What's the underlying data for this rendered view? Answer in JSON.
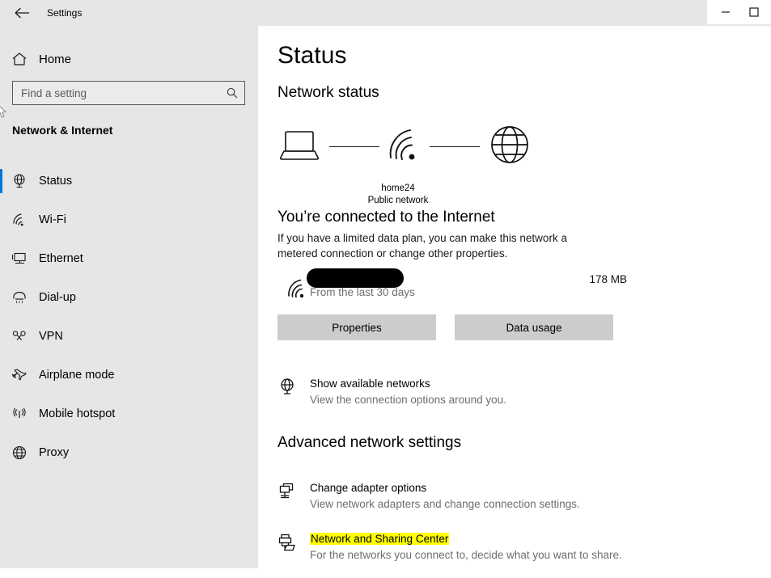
{
  "window": {
    "title": "Settings",
    "back_icon": "back-arrow-icon",
    "minimize_label": "—",
    "maximize_label": "❐"
  },
  "sidebar": {
    "home_label": "Home",
    "home_icon": "home-icon",
    "search": {
      "placeholder": "Find a setting",
      "value": "",
      "icon": "search-icon"
    },
    "category": "Network & Internet",
    "items": [
      {
        "label": "Status",
        "icon": "globe-monitor-icon",
        "selected": true
      },
      {
        "label": "Wi-Fi",
        "icon": "wifi-icon",
        "selected": false
      },
      {
        "label": "Ethernet",
        "icon": "ethernet-icon",
        "selected": false
      },
      {
        "label": "Dial-up",
        "icon": "dialup-phone-icon",
        "selected": false
      },
      {
        "label": "VPN",
        "icon": "vpn-key-icon",
        "selected": false
      },
      {
        "label": "Airplane mode",
        "icon": "airplane-icon",
        "selected": false
      },
      {
        "label": "Mobile hotspot",
        "icon": "hotspot-icon",
        "selected": false
      },
      {
        "label": "Proxy",
        "icon": "globe-icon",
        "selected": false
      }
    ]
  },
  "main": {
    "page_title": "Status",
    "network_status_heading": "Network status",
    "diagram": {
      "device_icon": "laptop-icon",
      "network_icon": "wifi-icon",
      "internet_icon": "globe-icon",
      "network_name": "home24",
      "network_type": "Public network"
    },
    "connected_heading": "You’re connected to the Internet",
    "connected_description": "If you have a limited data plan, you can make this network a metered connection or change other properties.",
    "usage": {
      "icon": "wifi-icon",
      "network_name_redacted": "",
      "period": "From the last 30 days",
      "amount": "178 MB"
    },
    "buttons": {
      "properties": "Properties",
      "data_usage": "Data usage"
    },
    "show_networks": {
      "icon": "globe-monitor-icon",
      "title": "Show available networks",
      "subtitle": "View the connection options around you."
    },
    "advanced_heading": "Advanced network settings",
    "advanced_items": [
      {
        "icon": "adapter-monitors-icon",
        "title": "Change adapter options",
        "subtitle": "View network adapters and change connection settings.",
        "highlighted": false
      },
      {
        "icon": "sharing-printer-folder-icon",
        "title": "Network and Sharing Center",
        "subtitle": "For the networks you connect to, decide what you want to share.",
        "highlighted": true
      }
    ]
  },
  "colors": {
    "accent": "#0078d7",
    "sidebar_bg": "#e6e6e6",
    "content_bg": "#ffffff",
    "button_bg": "#cccccc",
    "highlight": "#ffff00",
    "muted_text": "#6e6e6e"
  }
}
